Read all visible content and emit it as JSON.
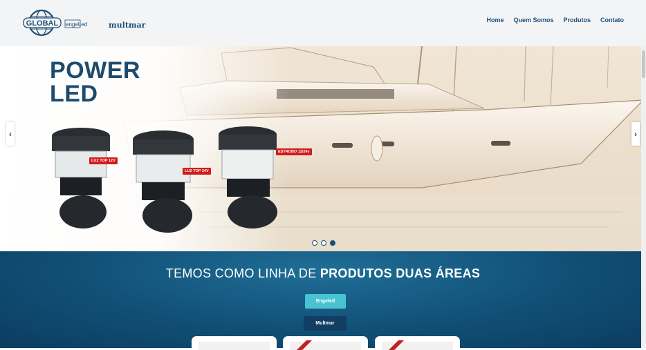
{
  "header": {
    "logo": {
      "brand1": "GLOBAL",
      "brand2": "engeLed",
      "brand3": "multmar"
    },
    "nav": [
      "Home",
      "Quem Somos",
      "Produtos",
      "Contato"
    ]
  },
  "slider": {
    "title_line1": "POWER",
    "title_line2": "LED",
    "products": [
      {
        "badge": "LUZ TOP 12V",
        "print": "www.multmar"
      },
      {
        "badge": "LUZ TOP 24V",
        "print": "www.multmar"
      },
      {
        "badge": "ESTROBO 12/24v",
        "print": "www.multmar"
      }
    ],
    "dots": {
      "count": 3,
      "active": 3
    },
    "prev_arrow": "‹",
    "next_arrow": "›"
  },
  "section": {
    "heading_prefix": "TEMOS COMO LINHA DE ",
    "heading_bold": "PRODUTOS DUAS ÁREAS",
    "buttons": [
      "Engeled",
      "Multmar"
    ]
  },
  "colors": {
    "primary": "#1d4e79",
    "accent": "#49c3d2",
    "badge": "#d21b1b",
    "section_bg": "#114f76"
  }
}
